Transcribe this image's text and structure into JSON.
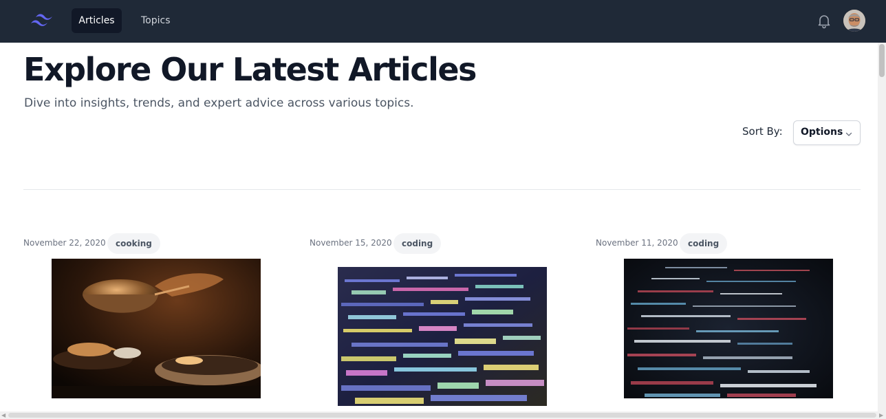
{
  "nav": {
    "logo": "tailwind-logo",
    "items": [
      {
        "label": "Articles",
        "active": true
      },
      {
        "label": "Topics",
        "active": false
      }
    ],
    "icons": {
      "notifications": "bell-icon",
      "profile": "user-avatar"
    }
  },
  "header": {
    "title": "Explore Our Latest Articles",
    "subtitle": "Dive into insights, trends, and expert advice across various topics."
  },
  "sort": {
    "label": "Sort By:",
    "selected": "Options"
  },
  "articles": [
    {
      "date": "November 22, 2020",
      "tag": "cooking",
      "image": "cooking-pan-photo"
    },
    {
      "date": "November 15, 2020",
      "tag": "coding",
      "image": "colorful-code-screen-photo"
    },
    {
      "date": "November 11, 2020",
      "tag": "coding",
      "image": "dark-code-screen-photo"
    }
  ],
  "colors": {
    "navbar": "#1f2937",
    "nav_active": "#111827",
    "logo": "#6366f1",
    "tag_bg": "#f3f4f6"
  }
}
